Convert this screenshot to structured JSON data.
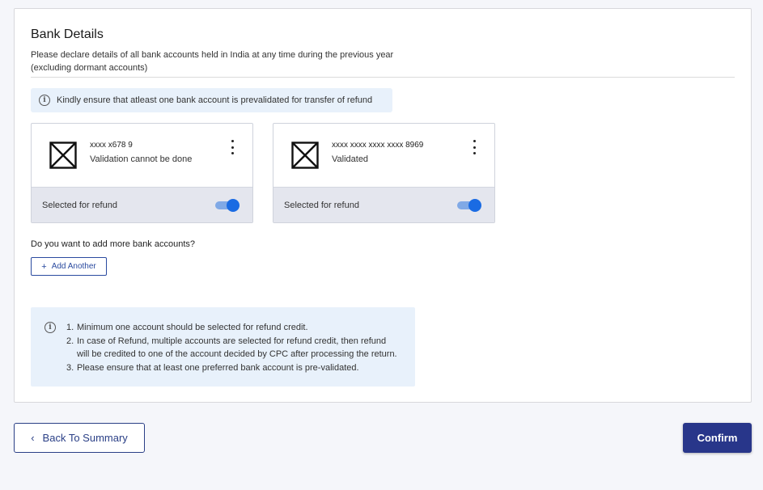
{
  "section": {
    "title": "Bank Details",
    "description_line1": "Please declare details of all bank accounts held in India at any time during the previous year",
    "description_line2": "(excluding dormant accounts)"
  },
  "banner": {
    "icon": "info-icon",
    "text": "Kindly ensure that atleast one bank account is prevalidated for transfer of refund"
  },
  "accounts": [
    {
      "logo_icon": "bank-logo-placeholder-icon",
      "number": "xxxx x678 9",
      "status": "Validation cannot be done",
      "refund_label": "Selected for refund",
      "selected_for_refund": true
    },
    {
      "logo_icon": "bank-logo-placeholder-icon",
      "number": "xxxx xxxx xxxx xxxx 8969",
      "status": "Validated",
      "refund_label": "Selected for refund",
      "selected_for_refund": true
    }
  ],
  "add_more": {
    "question": "Do you want to add more bank accounts?",
    "button_label": "Add Another",
    "button_icon": "+"
  },
  "notes": {
    "icon": "info-icon",
    "items": [
      {
        "num": "1.",
        "text": "Minimum one account should be selected for refund credit."
      },
      {
        "num": "2.",
        "text": "In case of Refund, multiple accounts are selected for refund credit, then refund"
      },
      {
        "num": "",
        "text": "will be credited to one of the account decided by CPC after processing the return."
      },
      {
        "num": "3.",
        "text": "Please ensure that at least one preferred bank account is pre-validated."
      }
    ]
  },
  "footer": {
    "back_label": "Back To Summary",
    "back_icon": "‹",
    "confirm_label": "Confirm"
  },
  "colors": {
    "primary": "#28368a",
    "toggle_on": "#1a6be3",
    "info_bg": "#e8f1fb"
  }
}
